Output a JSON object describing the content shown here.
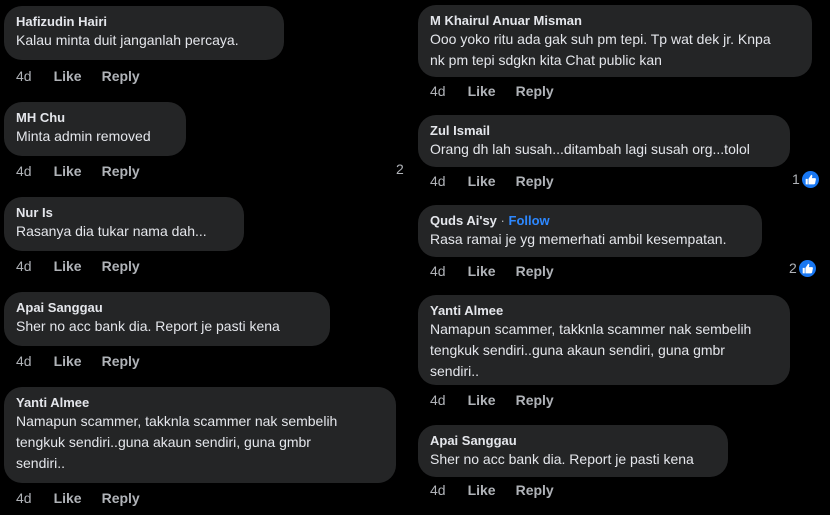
{
  "left": {
    "comments": [
      {
        "author": "Hafizudin Hairi",
        "text": "Kalau minta duit janganlah percaya.",
        "time": "4d",
        "like": "Like",
        "reply": "Reply"
      },
      {
        "author": "MH Chu",
        "text": "Minta admin removed",
        "time": "4d",
        "like": "Like",
        "reply": "Reply"
      },
      {
        "author": "Nur Is",
        "text": "Rasanya dia tukar nama dah...",
        "time": "4d",
        "like": "Like",
        "reply": "Reply"
      },
      {
        "author": "Apai Sanggau",
        "text": "Sher no acc bank dia. Report je pasti kena",
        "time": "4d",
        "like": "Like",
        "reply": "Reply"
      },
      {
        "author": "Yanti Almee",
        "text": "Namapun scammer, takknla scammer nak sembelih\ntengkuk sendiri..guna akaun sendiri, guna gmbr\nsendiri..",
        "time": "4d",
        "like": "Like",
        "reply": "Reply"
      }
    ],
    "edge_reaction_count": "2"
  },
  "right": {
    "comments": [
      {
        "author": "M Khairul Anuar Misman",
        "text": "Ooo yoko ritu ada gak suh pm tepi. Tp wat dek jr. Knpa\nnk pm tepi sdgkn kita Chat public kan",
        "time": "4d",
        "like": "Like",
        "reply": "Reply",
        "reactions": ""
      },
      {
        "author": "Zul Ismail",
        "text": "Orang dh lah susah...ditambah lagi susah org...tolol",
        "time": "4d",
        "like": "Like",
        "reply": "Reply",
        "reactions": "1"
      },
      {
        "author": "Quds Ai'sy",
        "separator": "·",
        "follow": "Follow",
        "text": "Rasa ramai je yg memerhati ambil kesempatan.",
        "time": "4d",
        "like": "Like",
        "reply": "Reply",
        "reactions": "2"
      },
      {
        "author": "Yanti Almee",
        "text": "Namapun scammer, takknla scammer nak sembelih\ntengkuk sendiri..guna akaun sendiri, guna gmbr\nsendiri..",
        "time": "4d",
        "like": "Like",
        "reply": "Reply",
        "reactions": ""
      },
      {
        "author": "Apai Sanggau",
        "text": "Sher no acc bank dia. Report je pasti kena",
        "time": "4d",
        "like": "Like",
        "reply": "Reply",
        "reactions": ""
      }
    ]
  },
  "icons": {
    "reaction": "like-icon"
  },
  "colors": {
    "background": "#000000",
    "bubble": "#242526",
    "text_primary": "#e4e6eb",
    "text_secondary": "#b0b3b8",
    "accent": "#2d88ff",
    "like_badge": "#1877f2"
  }
}
